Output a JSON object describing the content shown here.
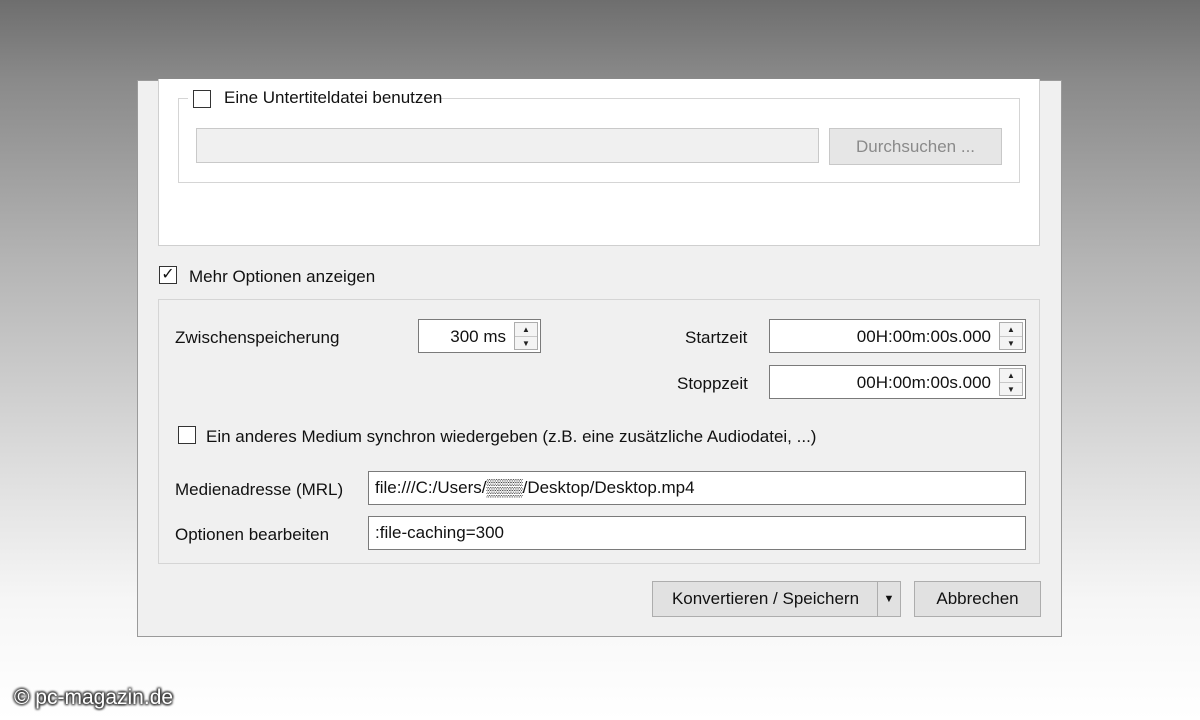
{
  "subtitle_group": {
    "checkbox_label": "Eine Untertiteldatei benutzen",
    "checked": false,
    "file_value": "",
    "browse_label": "Durchsuchen ..."
  },
  "more_options": {
    "label": "Mehr Optionen anzeigen",
    "checked": true,
    "checkmark": "✓"
  },
  "caching": {
    "label": "Zwischenspeicherung",
    "value": "300 ms"
  },
  "start_time": {
    "label": "Startzeit",
    "value": "00H:00m:00s.000"
  },
  "stop_time": {
    "label": "Stoppzeit",
    "value": "00H:00m:00s.000"
  },
  "sync": {
    "label": "Ein anderes Medium synchron wiedergeben (z.B. eine zusätzliche Audiodatei, ...)",
    "checked": false
  },
  "mrl": {
    "label": "Medienadresse (MRL)",
    "value": "file:///C:/Users/▒▒▒/Desktop/Desktop.mp4"
  },
  "edit_options": {
    "label": "Optionen bearbeiten",
    "value": ":file-caching=300"
  },
  "buttons": {
    "convert_label": "Konvertieren / Speichern",
    "dropdown_glyph": "▼",
    "cancel_label": "Abbrechen"
  },
  "spin_glyphs": {
    "up": "▲",
    "down": "▼"
  },
  "watermark": "© pc-magazin.de",
  "colors": {
    "dialog_bg": "#f0f0f0",
    "panel_white": "#ffffff",
    "border": "#7a7a7a"
  }
}
